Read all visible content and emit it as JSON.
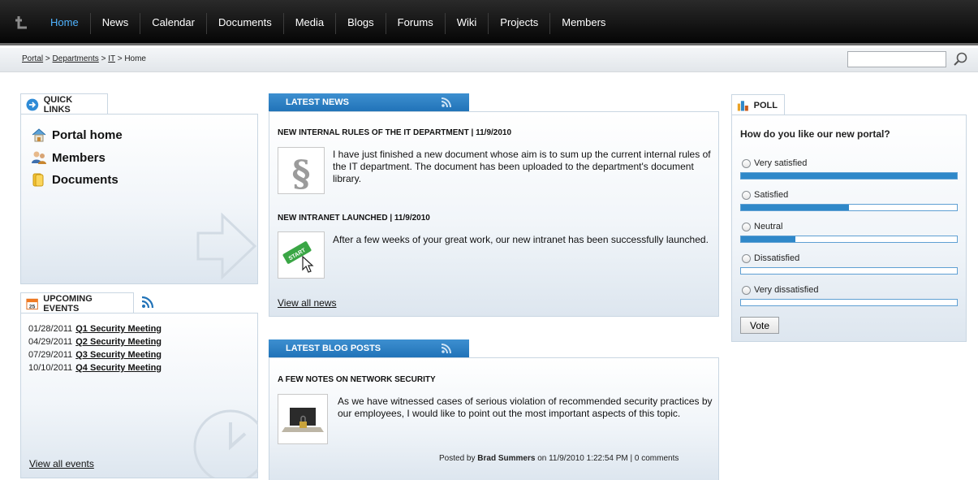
{
  "nav": {
    "items": [
      "Home",
      "News",
      "Calendar",
      "Documents",
      "Media",
      "Blogs",
      "Forums",
      "Wiki",
      "Projects",
      "Members"
    ],
    "active": "Home"
  },
  "breadcrumb": {
    "items": [
      "Portal",
      "Departments",
      "IT"
    ],
    "current": "Home",
    "separator": ">"
  },
  "search": {
    "value": ""
  },
  "quick_links": {
    "title": "QUICK LINKS",
    "items": [
      "Portal home",
      "Members",
      "Documents"
    ]
  },
  "events": {
    "title": "UPCOMING EVENTS",
    "items": [
      {
        "date": "01/28/2011",
        "name": "Q1 Security Meeting"
      },
      {
        "date": "04/29/2011",
        "name": "Q2 Security Meeting"
      },
      {
        "date": "07/29/2011",
        "name": "Q3 Security Meeting"
      },
      {
        "date": "10/10/2011",
        "name": "Q4 Security Meeting"
      }
    ],
    "view_all": "View all events"
  },
  "news": {
    "title": "LATEST NEWS",
    "items": [
      {
        "title": "NEW INTERNAL RULES OF THE IT DEPARTMENT | 11/9/2010",
        "text": "I have just finished a new document whose aim is to sum up the current internal rules of the IT department. The document has been uploaded to the department's document library."
      },
      {
        "title": "NEW INTRANET LAUNCHED | 11/9/2010",
        "text": "After a few weeks of your great work, our new intranet has been successfully launched."
      }
    ],
    "view_all": "View all news"
  },
  "blog": {
    "title": "LATEST BLOG POSTS",
    "post_title": "A FEW NOTES ON NETWORK SECURITY",
    "text": "As we have witnessed cases of serious violation of recommended security practices by our employees, I would like to point out the most important aspects of this topic.",
    "posted_by_prefix": "Posted by",
    "author": "Brad Summers",
    "posted_suffix": "on 11/9/2010 1:22:54 PM | 0 comments"
  },
  "poll": {
    "title": "POLL",
    "question": "How do you like our new portal?",
    "options": [
      {
        "label": "Very satisfied",
        "share": 1.0
      },
      {
        "label": "Satisfied",
        "share": 0.5
      },
      {
        "label": "Neutral",
        "share": 0.25
      },
      {
        "label": "Dissatisfied",
        "share": 0.0
      },
      {
        "label": "Very dissatisfied",
        "share": 0.0
      }
    ],
    "vote_label": "Vote"
  },
  "colors": {
    "accent": "#2f88c9",
    "active_nav": "#4fb3ff",
    "nav_bg": "#0c0c0c"
  }
}
